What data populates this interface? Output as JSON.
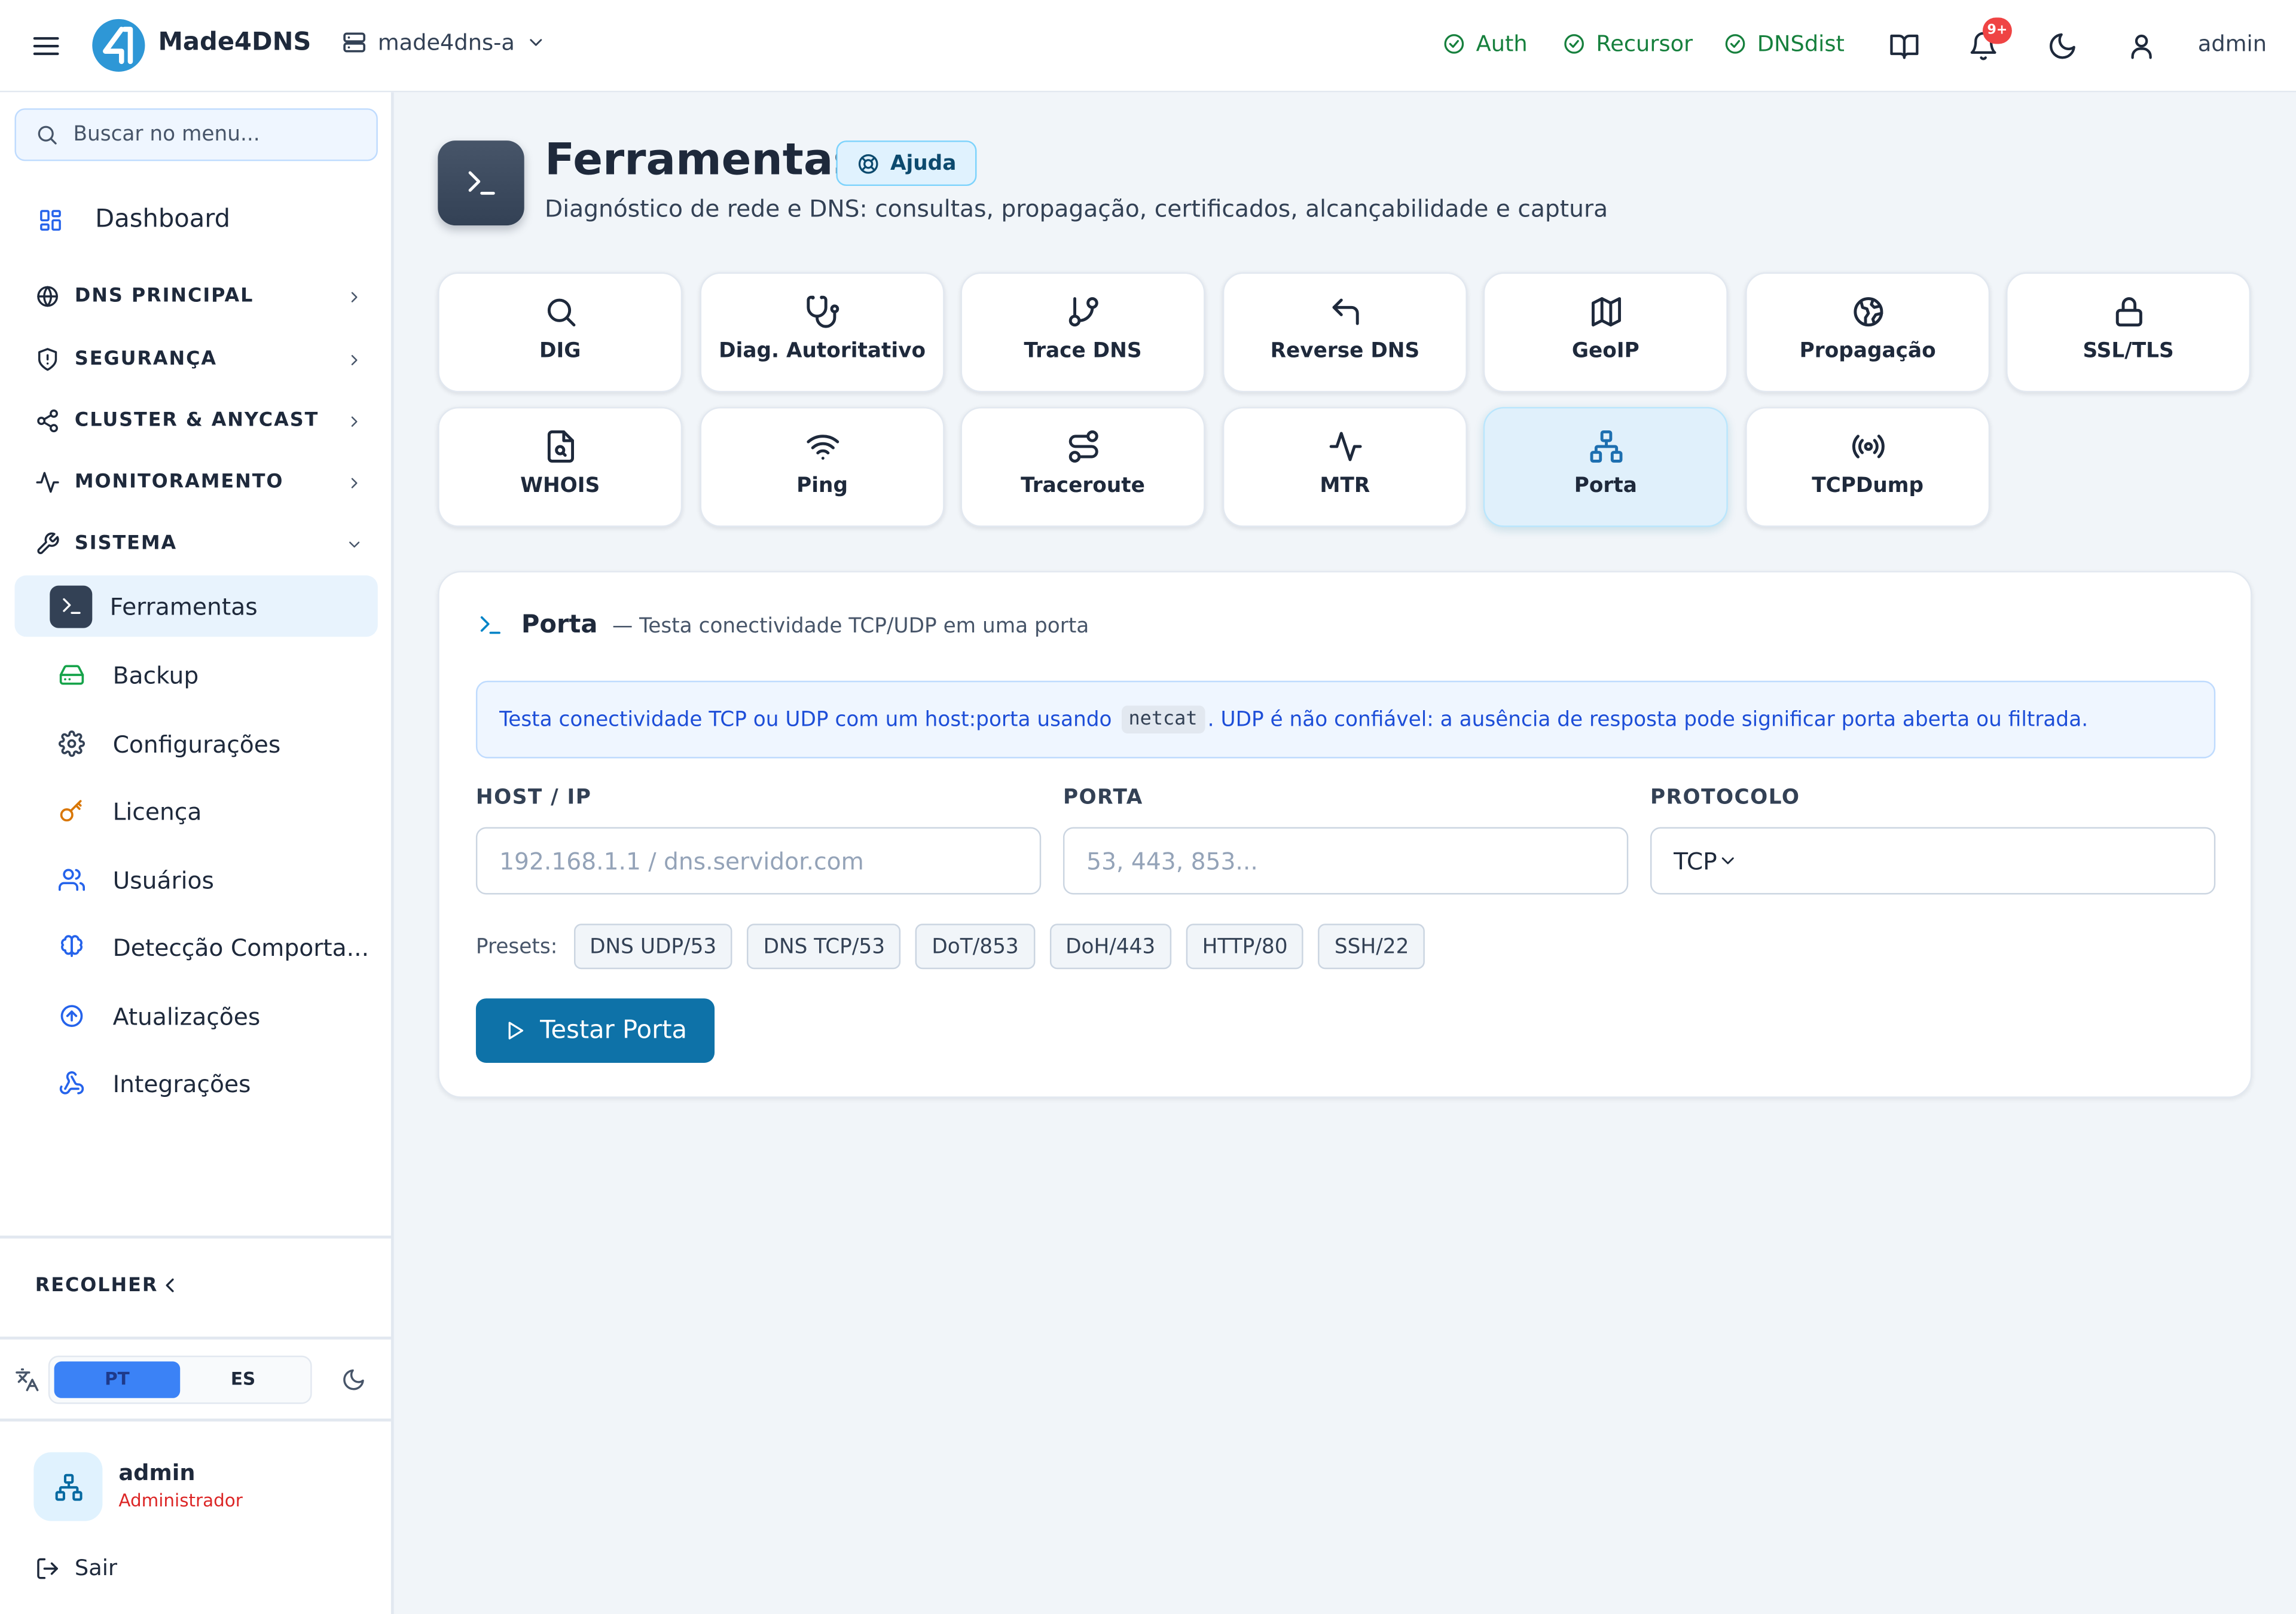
{
  "topbar": {
    "brand": "Made4DNS",
    "server": "made4dns-a",
    "services": [
      {
        "label": "Auth",
        "status_color": "#16803d"
      },
      {
        "label": "Recursor",
        "status_color": "#16803d"
      },
      {
        "label": "DNSdist",
        "status_color": "#16803d"
      }
    ],
    "notifications_badge": "9+",
    "user": "admin"
  },
  "sidebar": {
    "search_placeholder": "Buscar no menu...",
    "dashboard": "Dashboard",
    "sections": [
      {
        "label": "DNS PRINCIPAL",
        "icon": "globe-icon",
        "expanded": false
      },
      {
        "label": "SEGURANÇA",
        "icon": "shield-icon",
        "expanded": false
      },
      {
        "label": "CLUSTER & ANYCAST",
        "icon": "share-icon",
        "expanded": false
      },
      {
        "label": "MONITORAMENTO",
        "icon": "activity-icon",
        "expanded": false
      },
      {
        "label": "SISTEMA",
        "icon": "wrench-icon",
        "expanded": true
      }
    ],
    "system_items": [
      {
        "label": "Ferramentas",
        "icon": "terminal-icon",
        "active": true
      },
      {
        "label": "Backup",
        "icon": "hard-drive-icon"
      },
      {
        "label": "Configurações",
        "icon": "gear-icon"
      },
      {
        "label": "Licença",
        "icon": "key-icon"
      },
      {
        "label": "Usuários",
        "icon": "users-icon"
      },
      {
        "label": "Detecção Comporta...",
        "icon": "brain-icon"
      },
      {
        "label": "Atualizações",
        "icon": "arrow-up-circle-icon"
      },
      {
        "label": "Integrações",
        "icon": "webhook-icon"
      }
    ],
    "collapse": "RECOLHER",
    "languages": [
      "PT",
      "ES"
    ],
    "active_language": "PT",
    "user_name": "admin",
    "user_role": "Administrador",
    "logout": "Sair"
  },
  "page": {
    "title": "Ferramentas",
    "help": "Ajuda",
    "subtitle": "Diagnóstico de rede e DNS: consultas, propagação, certificados, alcançabilidade e captura"
  },
  "tools": [
    {
      "label": "DIG",
      "icon": "search-icon"
    },
    {
      "label": "Diag. Autoritativo",
      "icon": "stethoscope-icon"
    },
    {
      "label": "Trace DNS",
      "icon": "git-branch-icon"
    },
    {
      "label": "Reverse DNS",
      "icon": "undo-arrow-icon"
    },
    {
      "label": "GeoIP",
      "icon": "map-icon"
    },
    {
      "label": "Propagação",
      "icon": "globe-icon"
    },
    {
      "label": "SSL/TLS",
      "icon": "lock-icon"
    },
    {
      "label": "WHOIS",
      "icon": "file-search-icon"
    },
    {
      "label": "Ping",
      "icon": "wifi-icon"
    },
    {
      "label": "Traceroute",
      "icon": "route-icon"
    },
    {
      "label": "MTR",
      "icon": "activity-icon"
    },
    {
      "label": "Porta",
      "icon": "network-icon",
      "selected": true
    },
    {
      "label": "TCPDump",
      "icon": "radio-icon"
    }
  ],
  "card": {
    "title": "Porta",
    "description": "— Testa conectividade TCP/UDP em uma porta",
    "info_before": "Testa conectividade TCP ou UDP com um host:porta usando ",
    "info_code": "netcat",
    "info_after": ". UDP é não confiável: a ausência de resposta pode significar porta aberta ou filtrada.",
    "host_label": "HOST / IP",
    "host_placeholder": "192.168.1.1 / dns.servidor.com",
    "host_value": "",
    "port_label": "PORTA",
    "port_placeholder": "53, 443, 853...",
    "port_value": "",
    "protocol_label": "PROTOCOLO",
    "protocol_value": "TCP",
    "presets_label": "Presets:",
    "presets": [
      "DNS UDP/53",
      "DNS TCP/53",
      "DoT/853",
      "DoH/443",
      "HTTP/80",
      "SSH/22"
    ],
    "run_button": "Testar Porta"
  },
  "colors": {
    "accent": "#0e72a8",
    "status_ok": "#16803d",
    "badge": "#ef4444",
    "role": "#dc2626"
  }
}
